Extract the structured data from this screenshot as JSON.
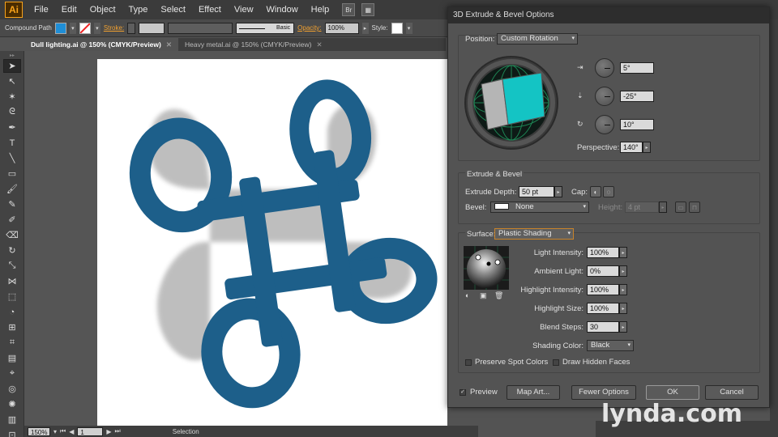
{
  "app": {
    "logo": "Ai"
  },
  "menu": [
    "File",
    "Edit",
    "Object",
    "Type",
    "Select",
    "Effect",
    "View",
    "Window",
    "Help"
  ],
  "menu_buttons": [
    "Br"
  ],
  "control": {
    "selection_type": "Compound Path",
    "stroke_label": "Stroke:",
    "brush": "Basic",
    "opacity_label": "Opacity:",
    "opacity": "100%",
    "style_label": "Style:",
    "fill_color": "#1f8ed6"
  },
  "tabs": [
    {
      "label": "Dull lighting.ai @ 150% (CMYK/Preview)",
      "active": true
    },
    {
      "label": "Heavy metal.ai @ 150% (CMYK/Preview)",
      "active": false
    }
  ],
  "status": {
    "zoom": "150%",
    "artboard": "1",
    "tool": "Selection"
  },
  "artwork_color": "#1d5f8a",
  "dialog": {
    "title": "3D Extrude & Bevel Options",
    "position_label": "Position:",
    "position_value": "Custom Rotation",
    "rot_x": "5°",
    "rot_y": "-25°",
    "rot_z": "10°",
    "perspective_label": "Perspective:",
    "perspective": "140°",
    "extrude_group": "Extrude & Bevel",
    "extrude_depth_label": "Extrude Depth:",
    "extrude_depth": "50 pt",
    "cap_label": "Cap:",
    "bevel_label": "Bevel:",
    "bevel": "None",
    "height_label": "Height:",
    "height": "4 pt",
    "surface_label": "Surface:",
    "surface": "Plastic Shading",
    "light_intensity_label": "Light Intensity:",
    "light_intensity": "100%",
    "ambient_light_label": "Ambient Light:",
    "ambient_light": "0%",
    "highlight_intensity_label": "Highlight Intensity:",
    "highlight_intensity": "100%",
    "highlight_size_label": "Highlight Size:",
    "highlight_size": "100%",
    "blend_steps_label": "Blend Steps:",
    "blend_steps": "30",
    "shading_color_label": "Shading Color:",
    "shading_color": "Black",
    "preserve_spot_label": "Preserve Spot Colors",
    "draw_hidden_label": "Draw Hidden Faces",
    "preview_label": "Preview",
    "map_art": "Map Art...",
    "fewer_options": "Fewer Options",
    "ok": "OK",
    "cancel": "Cancel",
    "cube_color": "#14c4c4"
  },
  "watermark": "lynda.com"
}
